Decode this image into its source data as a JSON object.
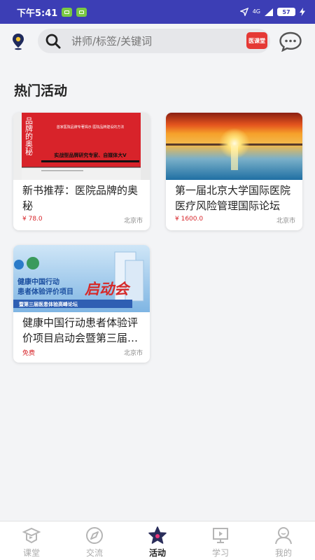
{
  "status_bar": {
    "time": "下午5:41",
    "network": "4G",
    "battery": "57"
  },
  "search": {
    "placeholder": "讲师/标签/关键词",
    "brand_badge": "医课堂"
  },
  "section": {
    "title": "热门活动"
  },
  "activities": [
    {
      "title": "新书推荐：医院品牌的奥秘",
      "price": "¥ 78.0",
      "city": "北京市",
      "image": {
        "vertical_title": "品牌的奥秘",
        "top_text": "首家医院品牌专著揭示\n医院品牌建设的方法",
        "bottom_text": "实战型品牌研究专家、自媒体大V"
      }
    },
    {
      "title": "第一届北京大学国际医院医疗风险管理国际论坛",
      "price": "¥ 1600.0",
      "city": "北京市",
      "image": {}
    },
    {
      "title": "健康中国行动患者体验评价项目启动会暨第三届医患体验高峰论坛",
      "price": "免费",
      "city": "北京市",
      "image": {
        "line1": "健康中国行动",
        "line2": "患者体验评价项目",
        "banner_script": "启动会",
        "subtitle": "暨第三届医患体验高峰论坛"
      }
    }
  ],
  "bottom_nav": [
    {
      "label": "课堂",
      "icon": "classroom-icon",
      "active": false
    },
    {
      "label": "交流",
      "icon": "compass-icon",
      "active": false
    },
    {
      "label": "活动",
      "icon": "star-icon",
      "active": true
    },
    {
      "label": "学习",
      "icon": "study-icon",
      "active": false
    },
    {
      "label": "我的",
      "icon": "profile-icon",
      "active": false
    }
  ],
  "colors": {
    "status_bar": "#3c3eb5",
    "price": "#d7262b",
    "brand": "#e53935"
  }
}
